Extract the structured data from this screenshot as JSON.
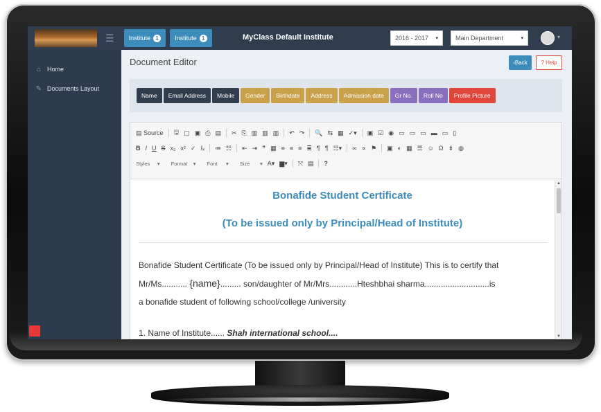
{
  "topnav": {
    "institute_tabs": [
      {
        "label": "Institute",
        "badge": "1"
      },
      {
        "label": "Institute",
        "badge": "1"
      }
    ],
    "brand": "MyClass Default Institute",
    "year_select": "2016 - 2017",
    "department_select": "Main Department"
  },
  "sidebar": {
    "items": [
      {
        "label": "Home",
        "icon": "home-icon"
      },
      {
        "label": "Documents Layout",
        "icon": "pencil-icon"
      }
    ]
  },
  "page": {
    "title": "Document Editor",
    "back_label": "‹Back",
    "help_label": "? Help"
  },
  "tags": [
    {
      "label": "Name",
      "color": "#2f3d4f"
    },
    {
      "label": "Email Address",
      "color": "#2f3d4f"
    },
    {
      "label": "Mobile",
      "color": "#2f3d4f"
    },
    {
      "label": "Gender",
      "color": "#c9a14a"
    },
    {
      "label": "Birthdate",
      "color": "#c9a14a"
    },
    {
      "label": "Address",
      "color": "#c9a14a"
    },
    {
      "label": "Admission date",
      "color": "#c9a14a"
    },
    {
      "label": "Gr No.",
      "color": "#8a6fbf"
    },
    {
      "label": "Roll No",
      "color": "#8a6fbf"
    },
    {
      "label": "Profile Picture",
      "color": "#e0463a"
    }
  ],
  "editor": {
    "toolbar": {
      "source_label": "Source",
      "styles_label": "Styles",
      "format_label": "Format",
      "font_label": "Font",
      "size_label": "Size"
    },
    "document": {
      "title": "Bonafide Student Certificate",
      "subtitle": "(To be issued only by Principal/Head of Institute)",
      "para_1": "Bonafide Student Certificate (To be issued only by Principal/Head of Institute) This is to certify that",
      "para_2a": "Mr/Ms...........",
      "para_2_placeholder": "{name}",
      "para_2b": "......... son/daughter of Mr/Mrs............Hteshbhai sharma............................is",
      "para_3": "a bonafide student of following school/college /university",
      "item_1_label": "1. Name of Institute......",
      "item_1_value": "Shah international school...."
    }
  }
}
